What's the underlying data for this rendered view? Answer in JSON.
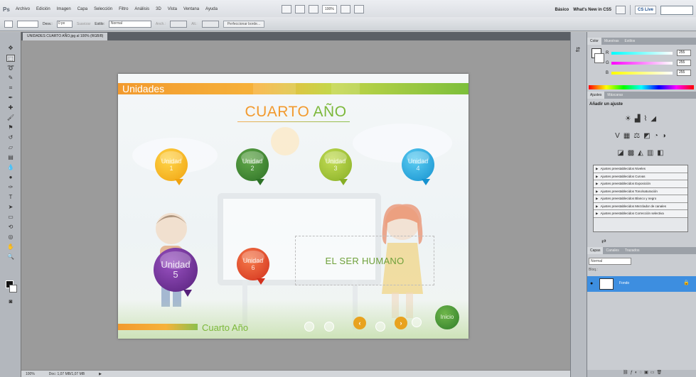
{
  "menubar": {
    "logo": "Ps",
    "items": [
      "Archivo",
      "Edición",
      "Imagen",
      "Capa",
      "Selección",
      "Filtro",
      "Análisis",
      "3D",
      "Vista",
      "Ventana",
      "Ayuda"
    ],
    "zoom": "100%",
    "workspace_basic": "Básico",
    "workspace_new": "What's New in CS5",
    "cs_live": "CS Live"
  },
  "optbar": {
    "feather_label": "Desv.:",
    "feather_value": "0 px",
    "antialias_label": "Suavizar",
    "style_label": "Estilo:",
    "style_value": "Normal",
    "width_label": "Anch.:",
    "height_label": "Alt.:",
    "refine_edge": "Perfeccionar borde..."
  },
  "document": {
    "tab_title": "UNIDADES CUARTO AÑO.jpg al 100% (RGB/8)",
    "header_title": "Unidades",
    "main_title_part1": "CUARTO",
    "main_title_part2": "AÑO",
    "content_text": "EL SER HUMANO",
    "bottom_title": "Cuarto Año",
    "home_button": "Inicio",
    "units": [
      {
        "label": "Unidad",
        "number": "1",
        "color": "#f6b91d"
      },
      {
        "label": "Unidad",
        "number": "2",
        "color": "#3f8d2f"
      },
      {
        "label": "Unidad",
        "number": "3",
        "color": "#9cc236"
      },
      {
        "label": "Unidad",
        "number": "4",
        "color": "#25a9e3"
      },
      {
        "label": "Unidad",
        "number": "5",
        "color": "#6a2b91"
      },
      {
        "label": "Unidad",
        "number": "6",
        "color": "#e8462a"
      }
    ],
    "nav_prev": "‹",
    "nav_next": "›"
  },
  "statusbar": {
    "zoom": "100%",
    "doc_size": "Doc: 1,07 MB/1,07 MB"
  },
  "panels": {
    "color_tabs": [
      "Color",
      "Muestras",
      "Estilos"
    ],
    "color_values": {
      "r": "255",
      "g": "255",
      "b": "255"
    },
    "adjust_tabs": [
      "Ajustes",
      "Máscaras"
    ],
    "adjust_title": "Añadir un ajuste",
    "presets": [
      "Ajustes preestablecidos Niveles",
      "Ajustes preestablecidos Curvas",
      "Ajustes preestablecidos Exposición",
      "Ajustes preestablecidos Tono/saturación",
      "Ajustes preestablecidos Blanco y negro",
      "Ajustes preestablecidos Mezclador de canales",
      "Ajustes preestablecidos Corrección selectiva"
    ],
    "layer_tabs": [
      "Capas",
      "Canales",
      "Trazados"
    ],
    "blend_mode": "Normal",
    "lock_label": "Bloq.:",
    "layer_name": "Fondo"
  }
}
